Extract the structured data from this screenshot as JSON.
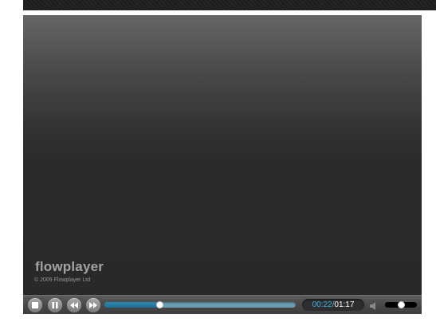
{
  "player": {
    "logo_text": "flowplayer",
    "copyright": "© 2009 Flowplayer Ltd"
  },
  "controls": {
    "stop_icon": "stop-icon",
    "pause_icon": "pause-icon",
    "rewind_icon": "rewind-icon",
    "fast_forward_icon": "fast-forward-icon",
    "mute_icon": "speaker-icon"
  },
  "time": {
    "elapsed": "00:22",
    "separator": "/",
    "duration": "01:17"
  },
  "progress": {
    "fraction": 0.2857
  },
  "volume": {
    "fraction": 0.5
  },
  "colors": {
    "accent": "#3ab0e0",
    "progress_fill": "#1e6f93",
    "progress_buffer": "#6b9fb5"
  }
}
